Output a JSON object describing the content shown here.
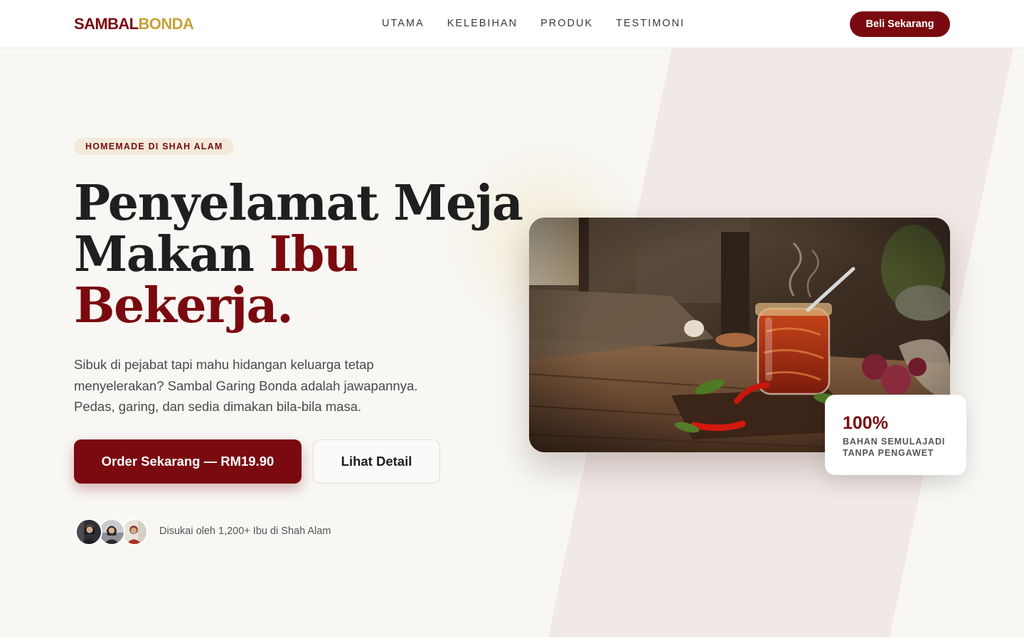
{
  "brand": {
    "part1": "SAMBAL",
    "part2": "BONDA",
    "primary_color": "#7a0a0f",
    "gold_color": "#c9a13a"
  },
  "nav": {
    "links": [
      "UTAMA",
      "KELEBIHAN",
      "PRODUK",
      "TESTIMONI"
    ],
    "cta_label": "Beli Sekarang"
  },
  "hero": {
    "badge": "HOMEMADE DI SHAH ALAM",
    "headline_line1": "Penyelamat Meja",
    "headline_line2_plain": "Makan ",
    "headline_line2_accent": "Ibu",
    "headline_line3_accent": "Bekerja.",
    "subtext": "Sibuk di pejabat tapi mahu hidangan keluarga tetap menyelerakan? Sambal Garing Bonda adalah jawapannya. Pedas, garing, dan sedia dimakan bila-bila masa.",
    "primary_button": "Order Sekarang — RM19.90",
    "secondary_button": "Lihat Detail",
    "social_proof": "Disukai oleh 1,200+ Ibu di Shah Alam",
    "avatars": [
      "avatar-1",
      "avatar-2",
      "avatar-3"
    ]
  },
  "stat_card": {
    "value": "100%",
    "label_line1": "BAHAN SEMULAJADI",
    "label_line2": "TANPA PENGAWET"
  }
}
